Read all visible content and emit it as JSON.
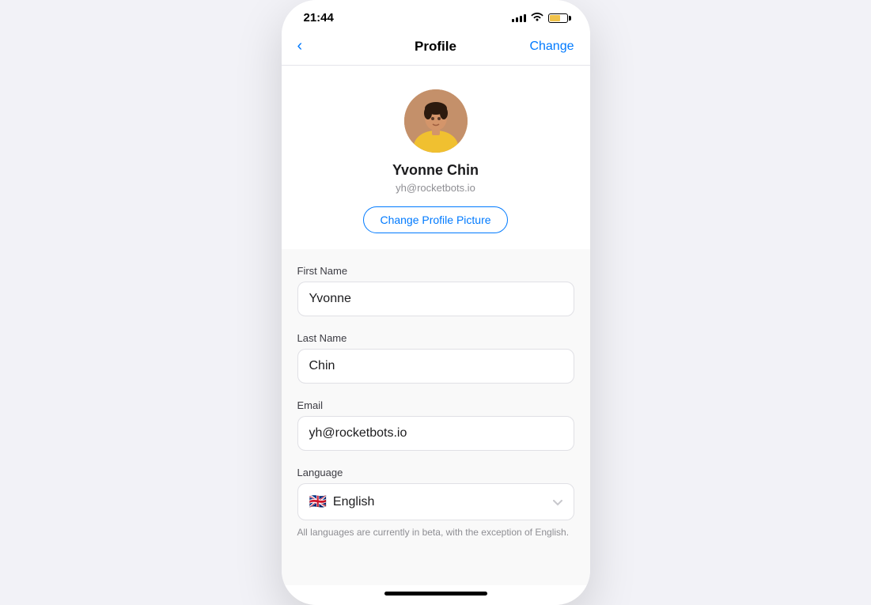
{
  "statusBar": {
    "time": "21:44"
  },
  "navBar": {
    "title": "Profile",
    "backLabel": "‹",
    "actionLabel": "Change"
  },
  "profile": {
    "name": "Yvonne Chin",
    "email": "yh@rocketbots.io",
    "changePictureLabel": "Change Profile Picture"
  },
  "form": {
    "firstNameLabel": "First Name",
    "firstNameValue": "Yvonne",
    "lastNameLabel": "Last Name",
    "lastNameValue": "Chin",
    "emailLabel": "Email",
    "emailValue": "yh@rocketbots.io",
    "languageLabel": "Language",
    "languageValue": "English",
    "languageFlagEmoji": "🇬🇧",
    "languageNote": "All languages are currently in beta, with the exception of English."
  }
}
